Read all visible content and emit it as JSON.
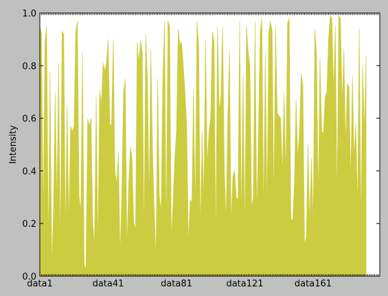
{
  "colors": {
    "background": "#c0c0c0",
    "plot_area": "#ffffff",
    "fill": "#cccc40",
    "axis": "#000000"
  },
  "chart_data": {
    "type": "area",
    "title": "",
    "xlabel": "",
    "ylabel": "Intensity",
    "ylim": [
      0,
      1
    ],
    "yticks": [
      "0.0",
      "0.2",
      "0.4",
      "0.6",
      "0.8",
      "1.0"
    ],
    "xtick_labels": [
      "data1",
      "data41",
      "data81",
      "data121",
      "data161"
    ],
    "x_category_prefix": "data",
    "x_count": 200,
    "grid": false,
    "legend": "none",
    "series": [
      {
        "values": [
          0.95,
          0.92,
          0.2,
          0.89,
          0.95,
          0.1,
          0.78,
          0.04,
          0.25,
          0.7,
          0.27,
          0.81,
          0.09,
          0.93,
          0.92,
          0.15,
          0.65,
          0.2,
          0.57,
          0.55,
          0.57,
          0.93,
          0.97,
          0.3,
          0.25,
          0.85,
          0.04,
          0.03,
          0.6,
          0.57,
          0.6,
          0.2,
          0.12,
          0.68,
          0.1,
          0.71,
          0.65,
          0.81,
          0.78,
          0.81,
          0.9,
          0.57,
          0.58,
          0.9,
          0.4,
          0.35,
          0.47,
          0.08,
          0.32,
          0.7,
          0.75,
          0.1,
          0.35,
          0.49,
          0.45,
          0.2,
          0.18,
          0.89,
          0.81,
          0.9,
          0.85,
          0.15,
          0.92,
          0.75,
          0.28,
          0.86,
          0.48,
          0.25,
          0.06,
          0.75,
          0.3,
          0.25,
          0.75,
          0.97,
          0.15,
          0.97,
          0.95,
          0.14,
          0.28,
          0.45,
          0.55,
          0.94,
          0.88,
          0.89,
          0.8,
          0.7,
          0.57,
          0.12,
          0.29,
          0.28,
          0.71,
          0.25,
          0.97,
          0.88,
          0.16,
          0.55,
          0.28,
          0.9,
          0.42,
          0.55,
          0.6,
          0.93,
          0.89,
          0.12,
          0.95,
          0.63,
          0.68,
          0.95,
          0.42,
          0.2,
          0.6,
          0.86,
          0.2,
          0.38,
          0.4,
          0.3,
          0.29,
          0.97,
          0.2,
          0.77,
          0.15,
          0.95,
          0.85,
          0.8,
          0.26,
          0.3,
          0.97,
          0.22,
          0.55,
          0.93,
          0.98,
          0.22,
          0.85,
          0.25,
          0.92,
          0.97,
          0.93,
          0.28,
          0.95,
          0.62,
          0.61,
          0.6,
          0.39,
          0.7,
          0.37,
          0.96,
          0.98,
          0.22,
          0.21,
          0.35,
          0.67,
          0.45,
          0.55,
          0.77,
          0.72,
          0.12,
          0.15,
          0.5,
          0.2,
          0.45,
          0.2,
          0.94,
          0.85,
          0.28,
          0.83,
          0.55,
          0.54,
          0.68,
          0.7,
          0.9,
          0.99,
          0.98,
          0.7,
          0.95,
          0.28,
          0.99,
          0.98,
          0.65,
          0.86,
          0.5,
          0.73,
          0.72,
          0.36,
          0.76,
          0.45,
          0.58,
          0.25,
          0.94,
          0.2,
          0.8,
          0.55,
          0.84
        ]
      }
    ]
  }
}
